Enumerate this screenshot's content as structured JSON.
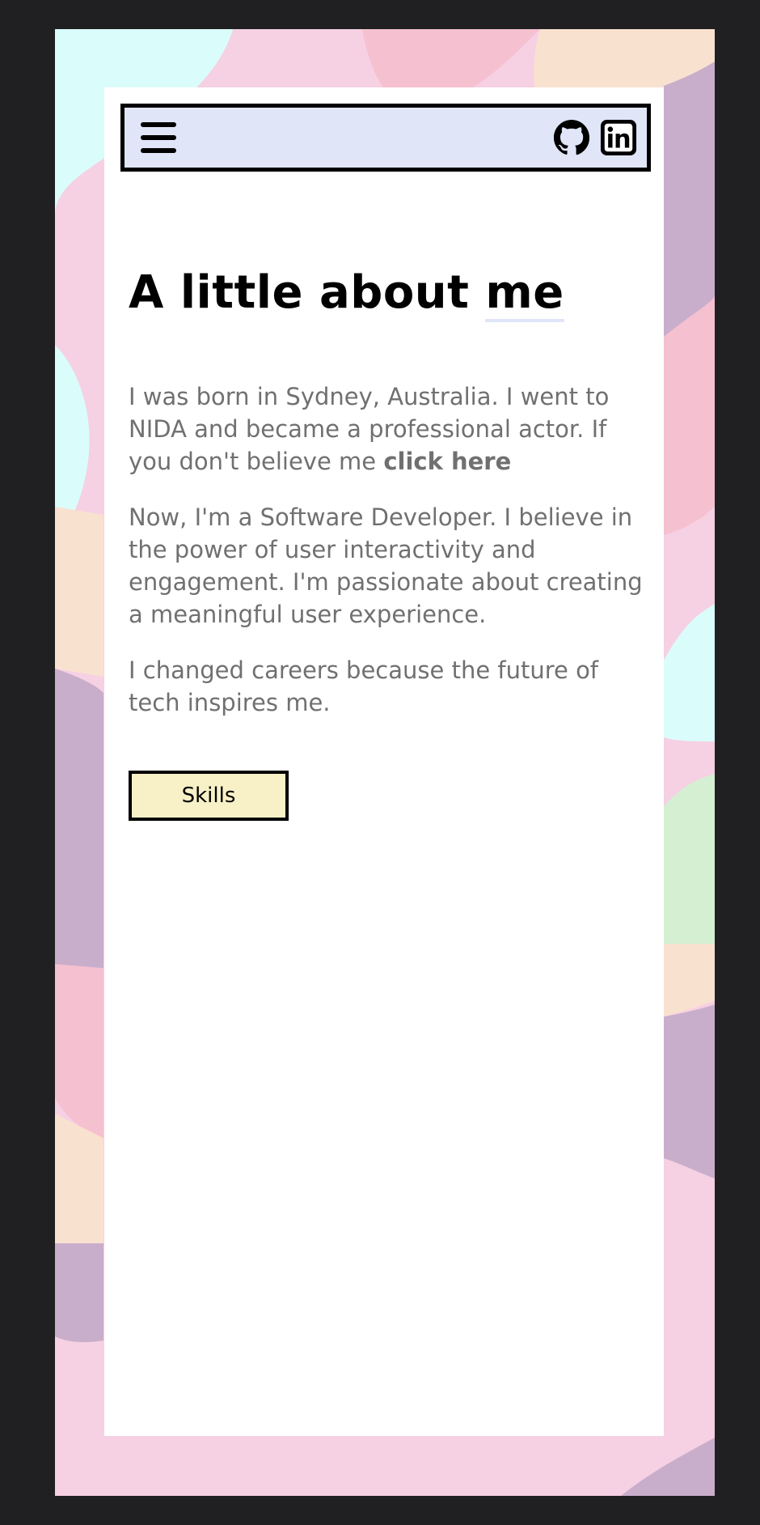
{
  "theme": {
    "frame_bg": "#202022",
    "card_bg": "#ffffff",
    "navbar_bg": "#e0e6f8",
    "text_color": "#707070",
    "heading_color": "#000000",
    "button_bg": "#f8f0c6",
    "blob_colors": [
      "#f6d0e3",
      "#c9aecb",
      "#f5c0d0",
      "#f9e1d0",
      "#dafdfb",
      "#d5efd3"
    ]
  },
  "navbar": {
    "menu_icon": "hamburger-menu-icon",
    "social_icons": [
      "github-icon",
      "linkedin-icon"
    ]
  },
  "about": {
    "heading_prefix": "A little about",
    "heading_emphasis": "me",
    "para1_text": "I was born in Sydney, Australia. I went to NIDA and became a professional actor. If you don't believe me",
    "para1_link": "click here",
    "para2": "Now, I'm a Software Developer. I believe in the power of user interactivity and engagement. I'm passionate about creating a meaningful user experience.",
    "para3": "I changed careers because the future of tech inspires me.",
    "skills_button": "Skills"
  }
}
